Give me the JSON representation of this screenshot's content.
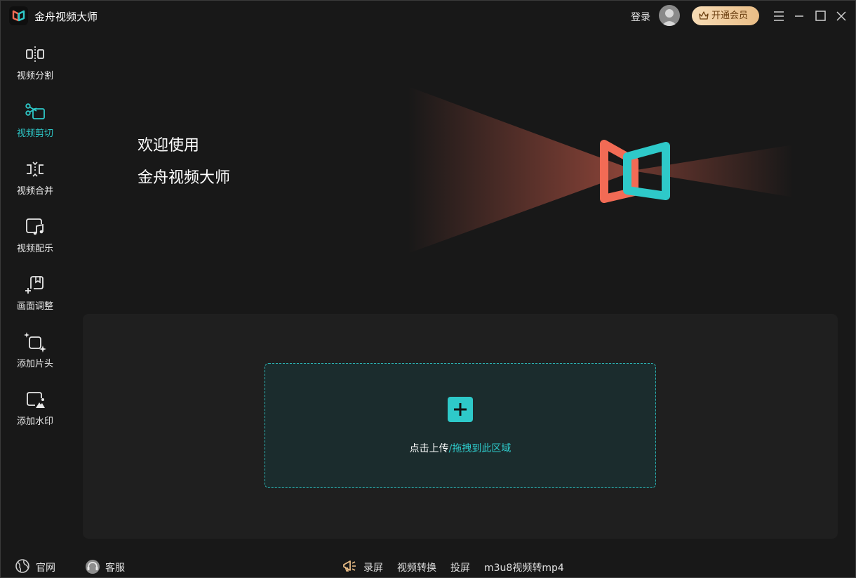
{
  "app": {
    "title": "金舟视频大师"
  },
  "header": {
    "login_label": "登录",
    "vip_label": "开通会员"
  },
  "sidebar": {
    "items": [
      {
        "label": "视频分割",
        "icon": "split-icon"
      },
      {
        "label": "视频剪切",
        "icon": "scissors-icon",
        "active": true
      },
      {
        "label": "视频合并",
        "icon": "merge-icon"
      },
      {
        "label": "视频配乐",
        "icon": "music-icon"
      },
      {
        "label": "画面调整",
        "icon": "crop-icon"
      },
      {
        "label": "添加片头",
        "icon": "sparkle-icon"
      },
      {
        "label": "添加水印",
        "icon": "watermark-icon"
      }
    ]
  },
  "hero": {
    "line1": "欢迎使用",
    "line2": "金舟视频大师"
  },
  "upload": {
    "primary_text": "点击上传",
    "secondary_text": "/拖拽到此区域"
  },
  "footer": {
    "website_label": "官网",
    "service_label": "客服",
    "links": [
      "录屏",
      "视频转换",
      "投屏",
      "m3u8视频转mp4"
    ]
  },
  "colors": {
    "accent": "#2ec9c9",
    "brand_coral": "#f26b55",
    "vip_gold": "#e9bd86",
    "background": "#181818"
  }
}
